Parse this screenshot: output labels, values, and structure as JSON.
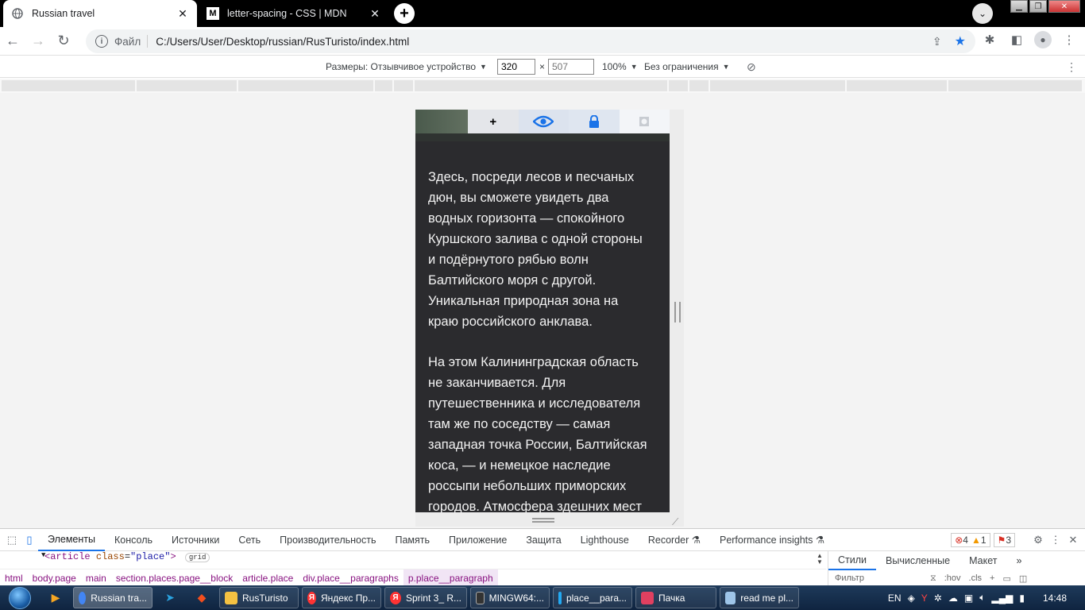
{
  "tabs": [
    {
      "title": "Russian travel",
      "active": true,
      "icon": "globe-icon"
    },
    {
      "title": "letter-spacing - CSS | MDN",
      "active": false,
      "icon": "mdn-logo-icon"
    }
  ],
  "toolbar": {
    "scheme": "Файл",
    "url": "C:/Users/User/Desktop/russian/RusTuristo/index.html"
  },
  "device_toolbar": {
    "dimensions_label": "Размеры: Отзывчивое устройство",
    "width": "320",
    "height": "507",
    "zoom": "100%",
    "throttle": "Без ограничения"
  },
  "page": {
    "paragraph1": {
      "lines": [
        "Здесь, посреди лесов и песчаных",
        "дюн, вы сможете увидеть два",
        "водных горизонта — спокойного",
        "Куршского залива с одной стороны",
        "и подёрнутого рябью волн",
        "Балтийского моря с другой.",
        "Уникальная природная зона на",
        "краю российского анклава."
      ]
    },
    "paragraph2": {
      "lines": [
        "На этом Калининградская область",
        "не заканчивается. Для",
        "путешественника и исследователя",
        "там же по соседству — самая",
        "западная точка России, Балтийская",
        "коса, — и немецкое наследие",
        "россыпи небольших приморских",
        "городов. Атмосфера здешних мест"
      ]
    }
  },
  "devtools": {
    "tabs": [
      "Элементы",
      "Консоль",
      "Источники",
      "Сеть",
      "Производительность",
      "Память",
      "Приложение",
      "Защита",
      "Lighthouse",
      "Recorder",
      "Performance insights"
    ],
    "active_tab": "Элементы",
    "errors": "4",
    "warnings": "1",
    "issues": "3",
    "code_line": {
      "tag_open": "<article",
      "attr": "class",
      "value": "\"place\"",
      "tag_close": ">",
      "badge": "grid"
    },
    "breadcrumbs": [
      "html",
      "body.page",
      "main",
      "section.places.page__block",
      "article.place",
      "div.place__paragraphs",
      "p.place__paragraph"
    ],
    "side_tabs": [
      "Стили",
      "Вычисленные",
      "Макет"
    ],
    "filter_placeholder": "Фильтр",
    "filter_hov": ":hov",
    "filter_cls": ".cls"
  },
  "taskbar": {
    "tasks": [
      {
        "label": "Russian tra...",
        "icon": "chrome-icon",
        "color": "#4285f4",
        "active": true
      },
      {
        "label": "RusTuristo",
        "icon": "folder-icon",
        "color": "#f5c242",
        "active": false
      },
      {
        "label": "Яндекс Пр...",
        "icon": "yandex-icon",
        "color": "#ff3333",
        "active": false
      },
      {
        "label": "Sprint 3_ R...",
        "icon": "yandex-icon",
        "color": "#ff3333",
        "active": false
      },
      {
        "label": "MINGW64:...",
        "icon": "terminal-icon",
        "color": "#333333",
        "active": false
      },
      {
        "label": "place__para...",
        "icon": "vscode-icon",
        "color": "#23a9f2",
        "active": false
      },
      {
        "label": "Пачка",
        "icon": "pachka-icon",
        "color": "#e04060",
        "active": false
      },
      {
        "label": "read me pl...",
        "icon": "notepad-icon",
        "color": "#9ec5e8",
        "active": false
      }
    ],
    "lang": "EN",
    "time": "14:48"
  },
  "colors": {
    "accent": "#1a73e8",
    "page_bg": "#2b2b2e",
    "viewport_bg": "#f3f3f3",
    "error": "#d93025",
    "warning": "#f29900"
  }
}
